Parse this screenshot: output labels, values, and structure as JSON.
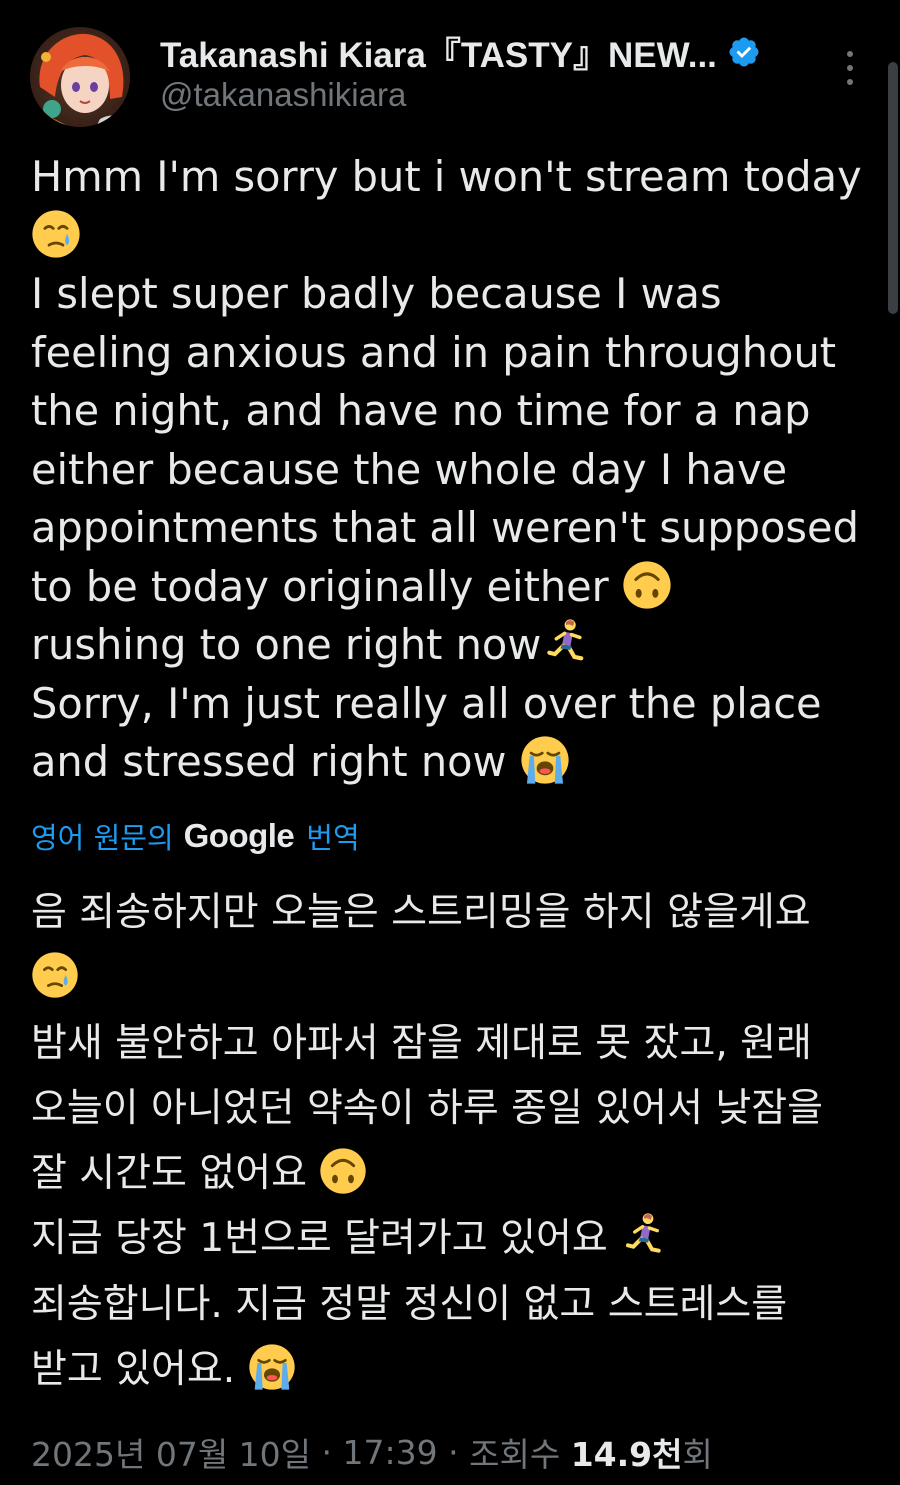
{
  "author": {
    "display_name": "Takanashi Kiara『TASTY』NEW...",
    "handle": "@takanashikiara",
    "verified": true
  },
  "tweet": {
    "lines": [
      {
        "text": "Hmm I'm sorry but i won't stream today",
        "emoji": null
      },
      {
        "text": "",
        "emoji": "crying-face"
      },
      {
        "text": "I slept super badly because I was",
        "emoji": null
      },
      {
        "text": "feeling anxious and in pain throughout",
        "emoji": null
      },
      {
        "text": "the night, and have no time for a nap",
        "emoji": null
      },
      {
        "text": "either because the whole day I have",
        "emoji": null
      },
      {
        "text": "appointments that all weren't supposed",
        "emoji": null
      },
      {
        "text": "to be today originally either ",
        "emoji": "upside-down-face"
      },
      {
        "text": "rushing to one right now",
        "emoji": "woman-running"
      },
      {
        "text": "Sorry, I'm just really all over the place",
        "emoji": null
      },
      {
        "text": "and stressed right now ",
        "emoji": "loudly-crying-face"
      }
    ]
  },
  "translation": {
    "prefix": "영어 원문의",
    "brand": "Google",
    "suffix": "번역",
    "lines": [
      {
        "text": "음 죄송하지만 오늘은 스트리밍을 하지 않을게요",
        "emoji": null
      },
      {
        "text": "",
        "emoji": "crying-face"
      },
      {
        "text": "밤새 불안하고 아파서 잠을 제대로 못 잤고, 원래",
        "emoji": null
      },
      {
        "text": "오늘이 아니었던 약속이 하루 종일 있어서 낮잠을",
        "emoji": null
      },
      {
        "text": "잘 시간도 없어요 ",
        "emoji": "upside-down-face"
      },
      {
        "text": "지금 당장 1번으로 달려가고 있어요 ",
        "emoji": "woman-running"
      },
      {
        "text": "죄송합니다. 지금 정말 정신이 없고 스트레스를",
        "emoji": null
      },
      {
        "text": "받고 있어요. ",
        "emoji": "loudly-crying-face"
      }
    ]
  },
  "meta": {
    "date": "2025년 07월 10일",
    "sep1": " · ",
    "time": "17:39",
    "sep2": " · ",
    "views_label": "조회수 ",
    "views_count": "14.9천",
    "views_suffix": "회"
  },
  "colors": {
    "background": "#000000",
    "text": "#e7e9ea",
    "secondary": "#71767b",
    "link": "#1d9bf0",
    "verified": "#1d9bf0"
  },
  "icons": {
    "verified": "verified-badge-icon",
    "more": "more-vertical-icon"
  }
}
